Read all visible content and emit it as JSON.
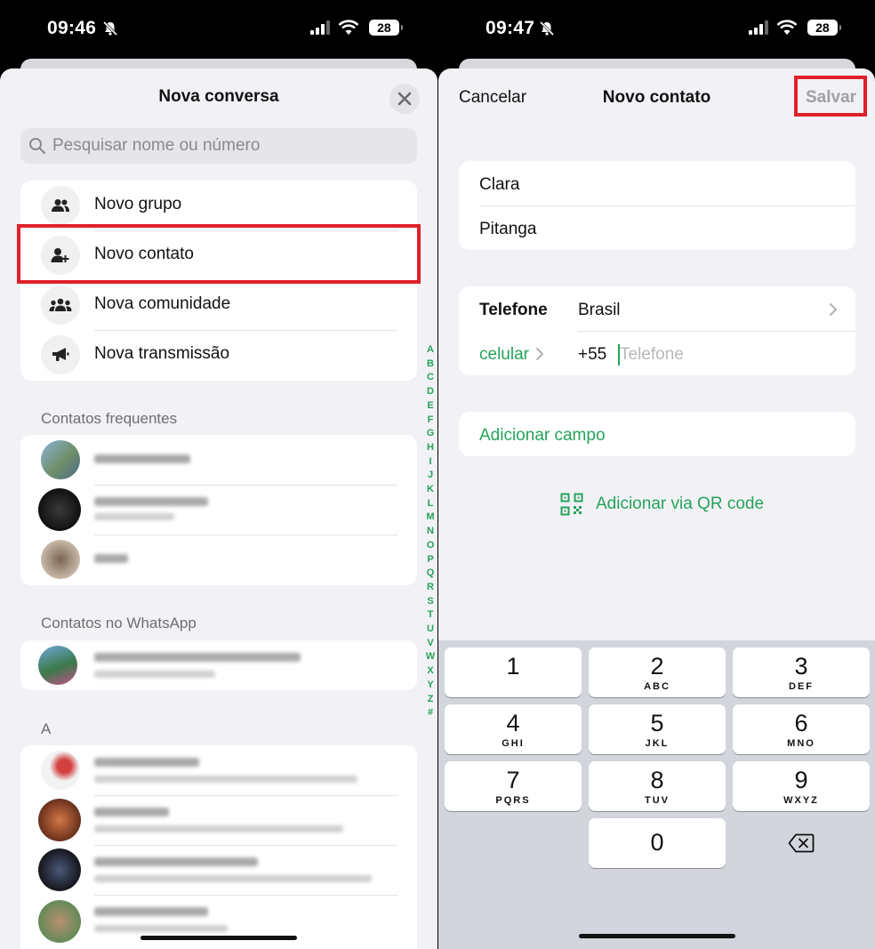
{
  "left": {
    "status": {
      "time": "09:46",
      "battery": "28"
    },
    "sheet_title": "Nova conversa",
    "search_placeholder": "Pesquisar nome ou número",
    "menu": [
      {
        "label": "Novo grupo",
        "icon": "group-icon"
      },
      {
        "label": "Novo contato",
        "icon": "add-person-icon"
      },
      {
        "label": "Nova comunidade",
        "icon": "community-icon"
      },
      {
        "label": "Nova transmissão",
        "icon": "megaphone-icon"
      }
    ],
    "frequent_header": "Contatos frequentes",
    "whatsapp_header": "Contatos no WhatsApp",
    "letter_header": "A",
    "alphabet": [
      "A",
      "B",
      "C",
      "D",
      "E",
      "F",
      "G",
      "H",
      "I",
      "J",
      "K",
      "L",
      "M",
      "N",
      "O",
      "P",
      "Q",
      "R",
      "S",
      "T",
      "U",
      "V",
      "W",
      "X",
      "Y",
      "Z",
      "#"
    ],
    "highlight_color": "#e0202a"
  },
  "right": {
    "status": {
      "time": "09:47",
      "battery": "28"
    },
    "cancel_label": "Cancelar",
    "sheet_title": "Novo contato",
    "save_label": "Salvar",
    "first_name": "Clara",
    "last_name": "Pitanga",
    "phone_label": "Telefone",
    "country": "Brasil",
    "phone_type": "celular",
    "country_code": "+55",
    "phone_placeholder": "Telefone",
    "add_field": "Adicionar campo",
    "add_qr": "Adicionar via QR code",
    "accent_color": "#25a35a",
    "keypad": [
      {
        "num": "1",
        "letters": ""
      },
      {
        "num": "2",
        "letters": "ABC"
      },
      {
        "num": "3",
        "letters": "DEF"
      },
      {
        "num": "4",
        "letters": "GHI"
      },
      {
        "num": "5",
        "letters": "JKL"
      },
      {
        "num": "6",
        "letters": "MNO"
      },
      {
        "num": "7",
        "letters": "PQRS"
      },
      {
        "num": "8",
        "letters": "TUV"
      },
      {
        "num": "9",
        "letters": "WXYZ"
      },
      {
        "num": "0",
        "letters": ""
      }
    ]
  }
}
